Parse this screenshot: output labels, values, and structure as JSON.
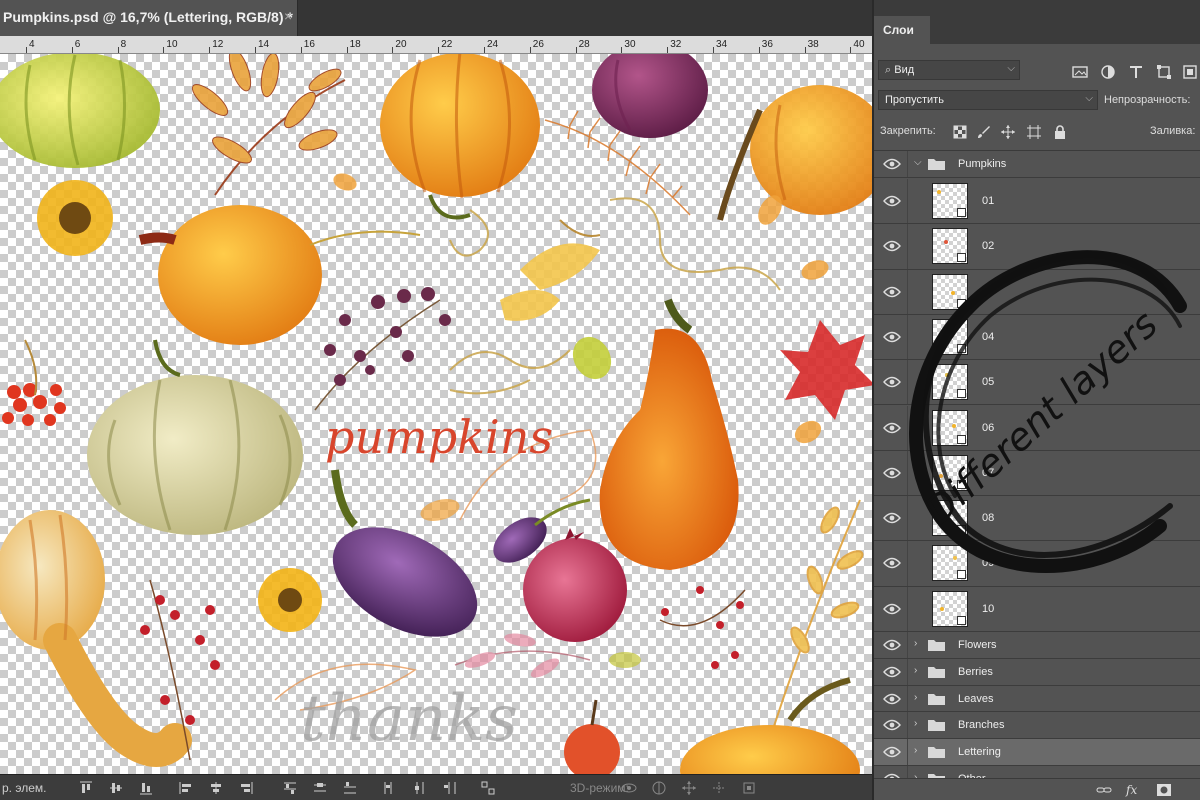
{
  "document": {
    "tab_title": "Pumpkins.psd @ 16,7% (Lettering, RGB/8) *",
    "close_glyph": "×",
    "ruler_ticks": [
      "4",
      "6",
      "8",
      "10",
      "12",
      "14",
      "16",
      "18",
      "20",
      "22",
      "24",
      "26",
      "28",
      "30",
      "32",
      "34",
      "36",
      "38",
      "40"
    ]
  },
  "canvas": {
    "lettering_main": "pumpkins",
    "lettering_secondary": "thanks"
  },
  "options_bar": {
    "align_label": "р. элем.",
    "mode_3d_label": "3D-режим:"
  },
  "panel": {
    "tab_label": "Слои",
    "filter_label": "Вид",
    "blend_mode": "Пропустить",
    "opacity_label": "Непрозрачность:",
    "lock_label": "Закрепить:",
    "fill_label": "Заливка:",
    "filter_icons": [
      "image-filter-icon",
      "adjustment-filter-icon",
      "type-filter-icon",
      "shape-filter-icon",
      "smart-object-filter-icon"
    ],
    "lock_icons": [
      "lock-transparent-icon",
      "lock-paint-icon",
      "lock-move-icon",
      "lock-artboard-icon",
      "lock-all-icon"
    ],
    "groups_top": {
      "name": "Pumpkins",
      "expanded": true
    },
    "pumpkin_layers": [
      "01",
      "02",
      "03",
      "04",
      "05",
      "06",
      "07",
      "08",
      "09",
      "10"
    ],
    "groups_bottom": [
      {
        "name": "Flowers",
        "selected": false
      },
      {
        "name": "Berries",
        "selected": false
      },
      {
        "name": "Leaves",
        "selected": false
      },
      {
        "name": "Branches",
        "selected": false
      },
      {
        "name": "Lettering",
        "selected": true
      },
      {
        "name": "Other",
        "selected": false
      }
    ],
    "footer_icons": [
      "link-icon",
      "fx-icon",
      "mask-icon"
    ],
    "footer_fx": "fx"
  },
  "annotation": {
    "text": "Different layers"
  },
  "colors": {
    "panel_bg": "#535353",
    "selected_row": "#6a6a6a",
    "annotation_ink": "#111111"
  }
}
